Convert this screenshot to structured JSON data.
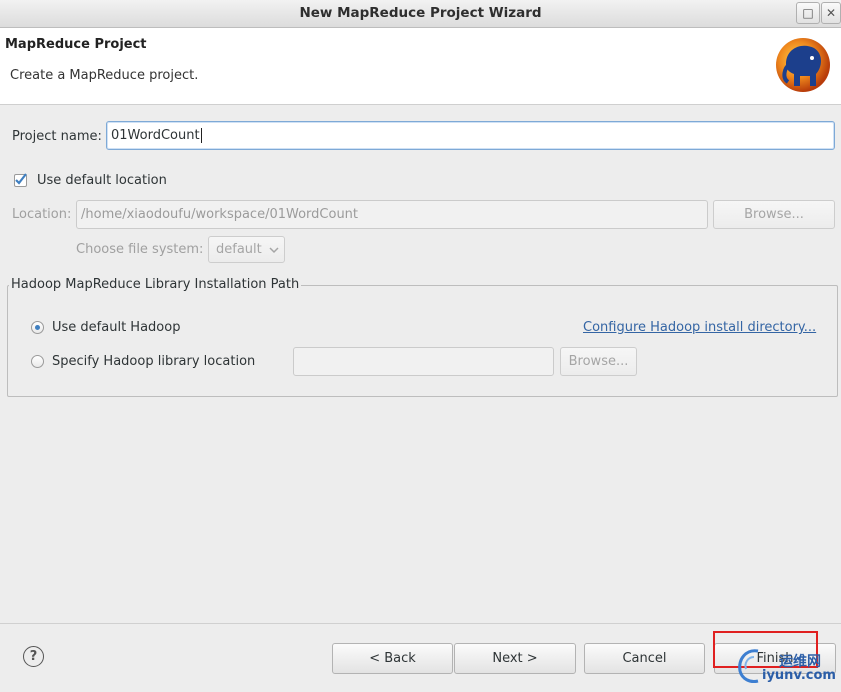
{
  "window": {
    "title": "New MapReduce Project Wizard"
  },
  "header": {
    "title": "MapReduce Project",
    "description": "Create a MapReduce project."
  },
  "form": {
    "project_name_label": "Project name:",
    "project_name_value": "01WordCount",
    "use_default_location_label": "Use default location",
    "use_default_location_checked": true,
    "location_label": "Location:",
    "location_value": "/home/xiaodoufu/workspace/01WordCount",
    "browse_location_label": "Browse...",
    "file_system_label": "Choose file system:",
    "file_system_value": "default"
  },
  "hadoop_group": {
    "legend": "Hadoop MapReduce Library Installation Path",
    "use_default_label": "Use default Hadoop",
    "use_default_selected": true,
    "configure_link": "Configure Hadoop install directory...",
    "specify_label": "Specify Hadoop library location",
    "specify_value": "",
    "browse_label": "Browse..."
  },
  "footer": {
    "back_label": "< Back",
    "next_label": "Next >",
    "cancel_label": "Cancel",
    "finish_label": "Finish"
  },
  "watermark": {
    "cn": "运维网",
    "domain": "iyunv.com"
  },
  "colors": {
    "highlight_box": "#e02020",
    "link": "#3465a4",
    "accent": "#3f7fc0"
  }
}
